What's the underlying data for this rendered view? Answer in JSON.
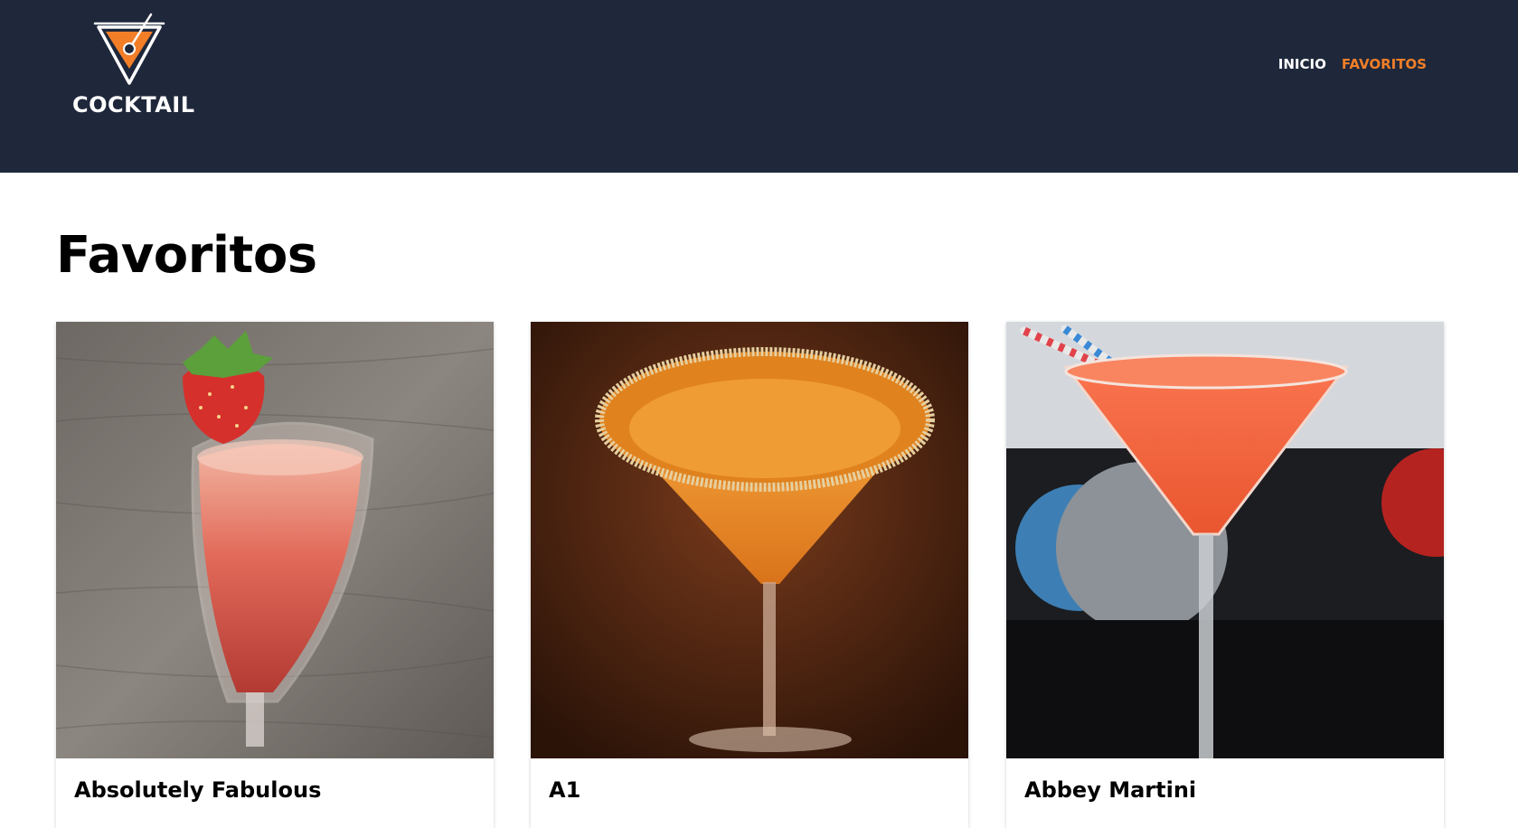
{
  "header": {
    "logo_text": "COCKTAIL",
    "logo_icon": "martini-glass-icon",
    "nav": [
      {
        "label": "INICIO",
        "active": false
      },
      {
        "label": "FAVORITOS",
        "active": true
      }
    ]
  },
  "main": {
    "title": "Favoritos",
    "cards": [
      {
        "name": "Absolutely Fabulous",
        "image": "strawberry-champagne-flute"
      },
      {
        "name": "A1",
        "image": "orange-martini-sugar-rim"
      },
      {
        "name": "Abbey Martini",
        "image": "orange-martini-with-straws"
      }
    ]
  },
  "colors": {
    "header_bg": "#1f283b",
    "accent": "#f27e28",
    "text": "#000000"
  }
}
